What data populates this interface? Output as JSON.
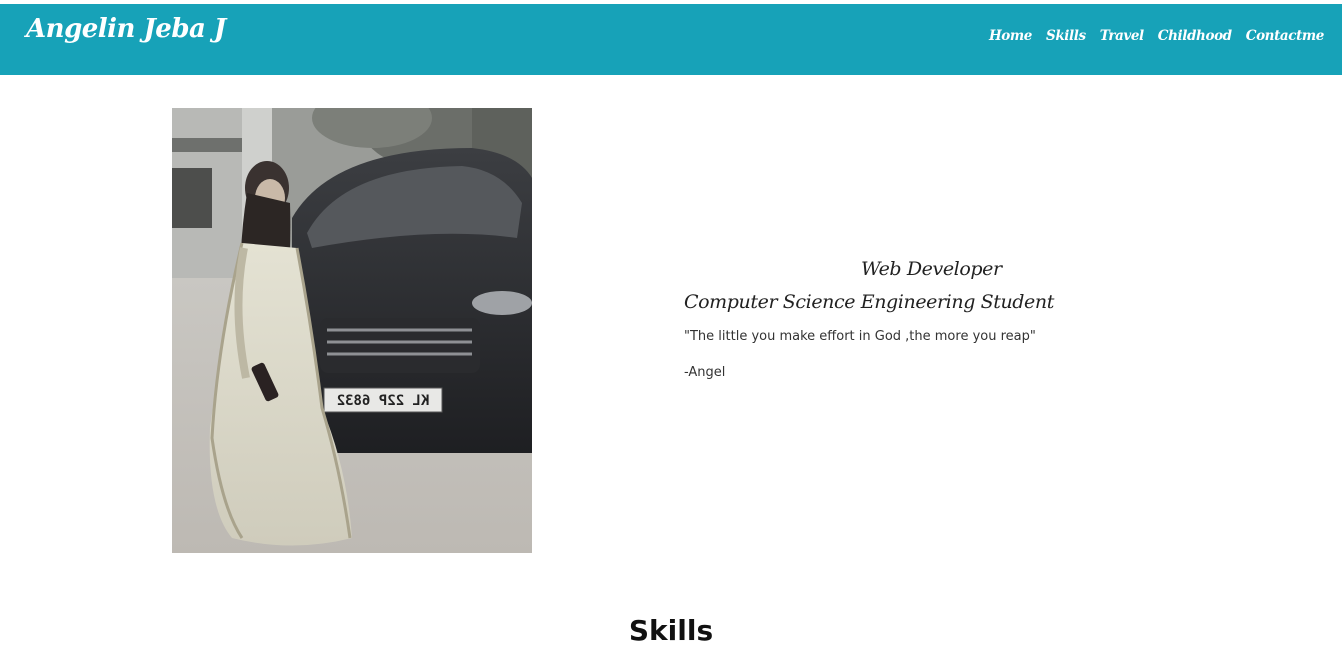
{
  "navbar": {
    "brand": "Angelin Jeba J",
    "links": [
      {
        "label": "Home"
      },
      {
        "label": "Skills"
      },
      {
        "label": "Travel"
      },
      {
        "label": "Childhood"
      },
      {
        "label": "Contactme"
      }
    ],
    "background_color": "#17a2b8"
  },
  "profile": {
    "photo": {
      "icon": "profile-photo",
      "plate_text": "KL 22P 6832"
    },
    "title": "Web Developer",
    "subtitle": "Computer Science Engineering Student",
    "quote": "\"The little you make effort in God ,the more you reap\"",
    "author": "-Angel"
  },
  "skills_section": {
    "heading": "Skills"
  }
}
